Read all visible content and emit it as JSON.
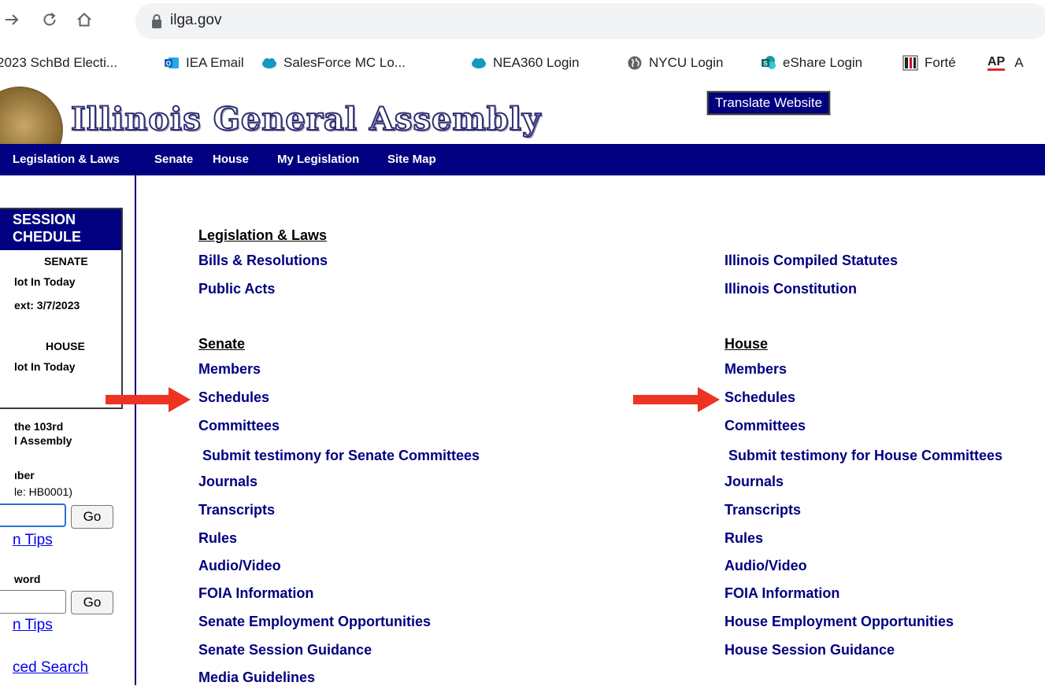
{
  "browser": {
    "url": "ilga.gov",
    "icons": {
      "forward": "arrow-right-icon",
      "reload": "reload-icon",
      "home": "home-icon",
      "lock": "lock-icon"
    }
  },
  "bookmarks": [
    {
      "label": "2023 SchBd Electi...",
      "icon": "none"
    },
    {
      "label": "IEA Email",
      "icon": "outlook-icon"
    },
    {
      "label": "SalesForce MC Lo...",
      "icon": "salesforce-cloud-icon"
    },
    {
      "label": "NEA360 Login",
      "icon": "salesforce-cloud-icon"
    },
    {
      "label": "NYCU Login",
      "icon": "globe-icon"
    },
    {
      "label": "eShare Login",
      "icon": "sharepoint-icon"
    },
    {
      "label": "Forté",
      "icon": "forte-icon"
    },
    {
      "label": "AP",
      "icon": "ap-logo"
    },
    {
      "label": "A",
      "icon": "none"
    }
  ],
  "header": {
    "site_title": "Illinois General Assembly",
    "translate_label": "Translate Website"
  },
  "nav": {
    "items": [
      "Legislation & Laws",
      "Senate",
      "House",
      "My Legislation",
      "Site Map"
    ]
  },
  "sidebar": {
    "session_title_1": "SESSION",
    "session_title_2": "CHEDULE",
    "senate_label": "SENATE",
    "senate_status": "lot In Today",
    "senate_next": "ext:  3/7/2023",
    "house_label": "HOUSE",
    "house_status": "lot In Today",
    "assembly_1": "the 103rd",
    "assembly_2": "l Assembly",
    "bill_label": "ıber",
    "bill_example": "le: HB0001)",
    "go_label": "Go",
    "tips_label": "n Tips",
    "keyword_label": "word",
    "go2_label": "Go",
    "tips2_label": "n Tips",
    "advanced_label": "ced Search"
  },
  "main": {
    "legislation_title": "Legislation & Laws",
    "legislation_links": [
      "Bills & Resolutions",
      "Public Acts"
    ],
    "legislation_right": [
      "Illinois Compiled Statutes",
      "Illinois Constitution"
    ],
    "senate_title": "Senate",
    "senate_links": [
      "Members",
      "Schedules",
      "Committees",
      " Submit testimony for Senate Committees",
      "Journals",
      "Transcripts",
      "Rules",
      "Audio/Video",
      "FOIA Information",
      "Senate Employment Opportunities",
      "Senate Session Guidance",
      "Media Guidelines"
    ],
    "house_title": "House",
    "house_links": [
      "Members",
      "Schedules",
      "Committees",
      " Submit testimony for House Committees",
      "Journals",
      "Transcripts",
      "Rules",
      "Audio/Video",
      "FOIA Information",
      "House Employment Opportunities",
      "House Session Guidance"
    ]
  },
  "annotations": {
    "arrow_color": "#ee3322",
    "arrow_targets": [
      "Senate Schedules",
      "House Schedules"
    ]
  }
}
